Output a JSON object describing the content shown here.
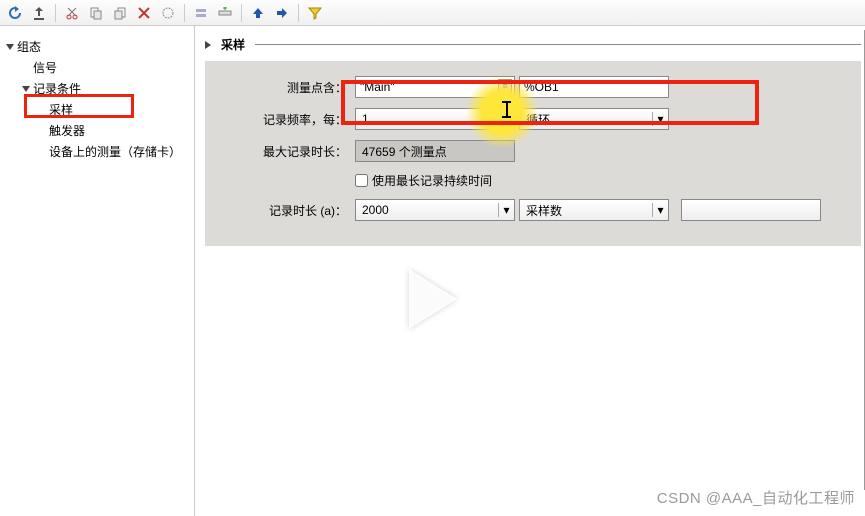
{
  "toolbar_icons": [
    "refresh-icon",
    "export-icon",
    "cut-icon",
    "copy-left-icon",
    "copy-right-icon",
    "delete-icon",
    "circle-icon",
    "collapse-icon",
    "insert-row-icon",
    "up-arrow-icon",
    "right-arrow-icon",
    "filter-icon"
  ],
  "sidebar": {
    "items": [
      {
        "label": "组态",
        "level": 0,
        "expanded": true
      },
      {
        "label": "信号",
        "level": 1,
        "expanded": null
      },
      {
        "label": "记录条件",
        "level": 1,
        "expanded": true
      },
      {
        "label": "采样",
        "level": 2,
        "expanded": null,
        "highlighted": true
      },
      {
        "label": "触发器",
        "level": 2,
        "expanded": null
      },
      {
        "label": "设备上的测量（存储卡）",
        "level": 2,
        "expanded": null
      }
    ]
  },
  "section": {
    "title": "采样"
  },
  "form": {
    "measure_label": "测量点含：",
    "measure_value": "\"Main\"",
    "block_value": "%OB1",
    "freq_label": "记录频率，每：",
    "freq_value": "1",
    "freq_unit": "循环",
    "maxlen_label": "最大记录时长：",
    "maxlen_value": "47659 个测量点",
    "use_max_label": "使用最长记录持续时间",
    "use_max_checked": false,
    "duration_label": "记录时长 (a)：",
    "duration_value": "2000",
    "duration_unit": "采样数"
  },
  "watermark": "CSDN @AAA_自动化工程师"
}
